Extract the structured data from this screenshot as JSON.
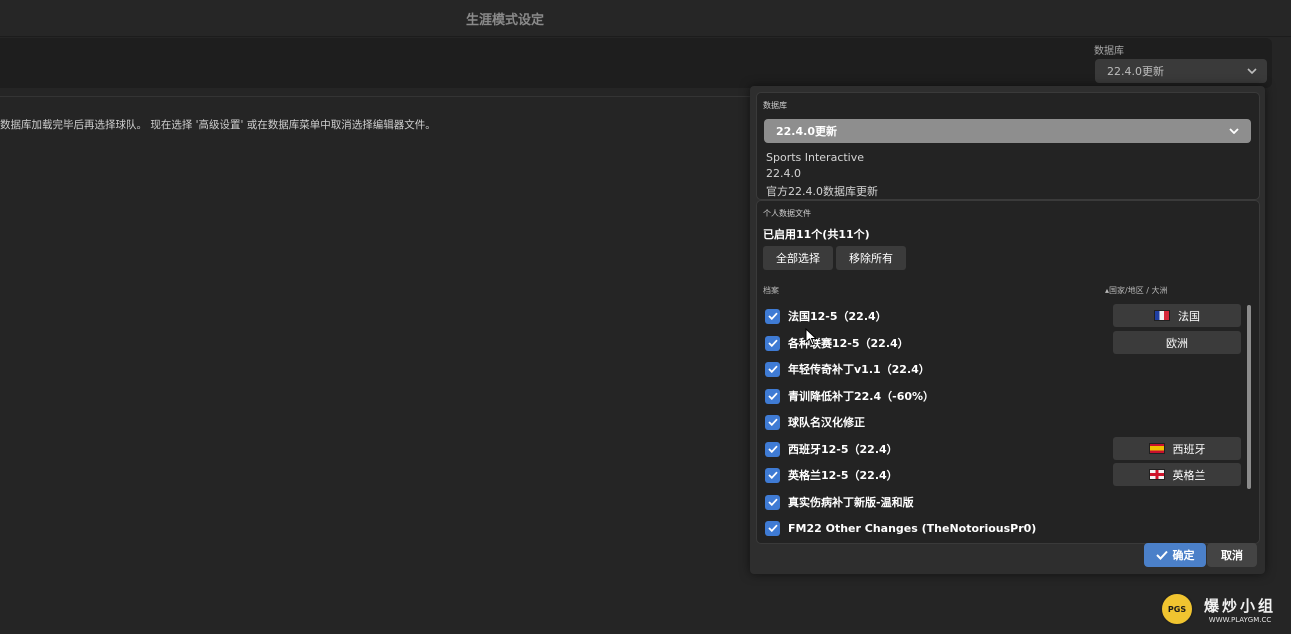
{
  "page_title": "生涯模式设定",
  "header": {
    "db_label": "数据库",
    "db_selected": "22.4.0更新"
  },
  "info_message": "数据库加载完毕后再选择球队。 现在选择 '高级设置' 或在数据库菜单中取消选择编辑器文件。",
  "panel": {
    "db_section": {
      "label": "数据库",
      "selected": "22.4.0更新",
      "publisher": "Sports Interactive",
      "version": "22.4.0",
      "description": "官方22.4.0数据库更新"
    },
    "files_section": {
      "label": "个人数据文件",
      "enabled_count": "已启用11个(共11个)",
      "select_all": "全部选择",
      "remove_all": "移除所有",
      "col_file": "档案",
      "col_region": "▴国家/地区 / 大洲",
      "files": [
        {
          "name": "法国12-5（22.4）",
          "checked": true,
          "region": "法国",
          "flag": "fr"
        },
        {
          "name": "各种联赛12-5（22.4）",
          "checked": true,
          "region": "欧洲",
          "flag": ""
        },
        {
          "name": "年轻传奇补丁v1.1（22.4）",
          "checked": true,
          "region": "",
          "flag": ""
        },
        {
          "name": "青训降低补丁22.4（-60%）",
          "checked": true,
          "region": "",
          "flag": ""
        },
        {
          "name": "球队名汉化修正",
          "checked": true,
          "region": "",
          "flag": ""
        },
        {
          "name": "西班牙12-5（22.4）",
          "checked": true,
          "region": "西班牙",
          "flag": "es"
        },
        {
          "name": "英格兰12-5（22.4）",
          "checked": true,
          "region": "英格兰",
          "flag": "en"
        },
        {
          "name": "真实伤病补丁新版-温和版",
          "checked": true,
          "region": "",
          "flag": ""
        },
        {
          "name": "FM22 Other Changes (TheNotoriousPr0)",
          "checked": true,
          "region": "",
          "flag": ""
        }
      ]
    },
    "ok_label": "确定",
    "cancel_label": "取消"
  },
  "watermark": {
    "logo_text": "PGS",
    "name": "爆炒小组",
    "url": "WWW.PLAYGM.CC"
  }
}
